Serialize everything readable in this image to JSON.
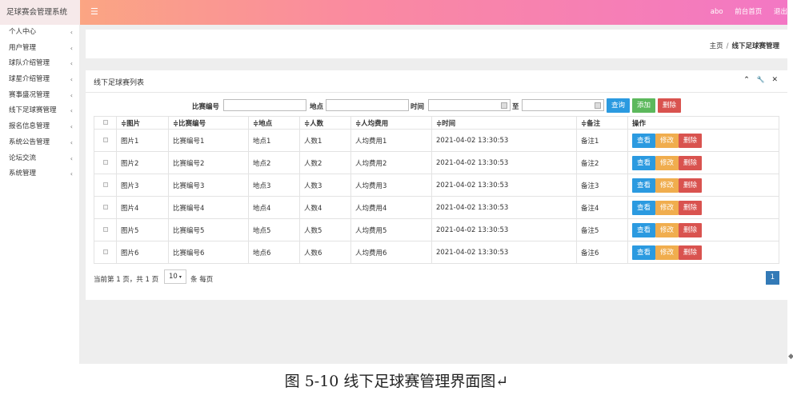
{
  "header": {
    "brand": "足球赛会管理系统",
    "menu_icon": "☰",
    "user": "abo",
    "front_link": "前台首页",
    "logout": "退出"
  },
  "sidebar": {
    "items": [
      {
        "label": "个人中心"
      },
      {
        "label": "用户管理"
      },
      {
        "label": "球队介绍管理"
      },
      {
        "label": "球星介绍管理"
      },
      {
        "label": "赛事盛况管理"
      },
      {
        "label": "线下足球赛管理"
      },
      {
        "label": "报名信息管理"
      },
      {
        "label": "系统公告管理"
      },
      {
        "label": "论坛交流"
      },
      {
        "label": "系统管理"
      }
    ],
    "chevron": "‹"
  },
  "breadcrumb": {
    "home": "主页",
    "separator": "/",
    "current": "线下足球赛管理"
  },
  "panel": {
    "title": "线下足球赛列表",
    "tools": {
      "collapse": "⌃",
      "wrench": "🔧",
      "close": "✕"
    }
  },
  "search": {
    "match_no_label": "比赛编号",
    "match_no_value": "",
    "place_label": "地点",
    "place_value": "",
    "time_label": "时间",
    "to_label": "至",
    "search_btn": "查询",
    "add_btn": "添加",
    "delete_btn": "删除"
  },
  "table": {
    "headers": {
      "image": "≑图片",
      "match_no": "≑比赛编号",
      "place": "≑地点",
      "count": "≑人数",
      "fee": "≑人均费用",
      "time": "≑时间",
      "note": "≑备注",
      "ops": "操作"
    },
    "ops": {
      "view": "查看",
      "edit": "修改",
      "delete": "删除"
    },
    "rows": [
      {
        "image": "图片1",
        "match_no": "比赛编号1",
        "place": "地点1",
        "count": "人数1",
        "fee": "人均费用1",
        "time": "2021-04-02 13:30:53",
        "note": "备注1"
      },
      {
        "image": "图片2",
        "match_no": "比赛编号2",
        "place": "地点2",
        "count": "人数2",
        "fee": "人均费用2",
        "time": "2021-04-02 13:30:53",
        "note": "备注2"
      },
      {
        "image": "图片3",
        "match_no": "比赛编号3",
        "place": "地点3",
        "count": "人数3",
        "fee": "人均费用3",
        "time": "2021-04-02 13:30:53",
        "note": "备注3"
      },
      {
        "image": "图片4",
        "match_no": "比赛编号4",
        "place": "地点4",
        "count": "人数4",
        "fee": "人均费用4",
        "time": "2021-04-02 13:30:53",
        "note": "备注4"
      },
      {
        "image": "图片5",
        "match_no": "比赛编号5",
        "place": "地点5",
        "count": "人数5",
        "fee": "人均费用5",
        "time": "2021-04-02 13:30:53",
        "note": "备注5"
      },
      {
        "image": "图片6",
        "match_no": "比赛编号6",
        "place": "地点6",
        "count": "人数6",
        "fee": "人均费用6",
        "time": "2021-04-02 13:30:53",
        "note": "备注6"
      }
    ]
  },
  "pagination": {
    "summary": "当前第 1 页，共 1 页",
    "page_size": "10",
    "per_page": "条 每页",
    "current_page": "1"
  },
  "caption": "图 5-10 线下足球赛管理界面图↵"
}
